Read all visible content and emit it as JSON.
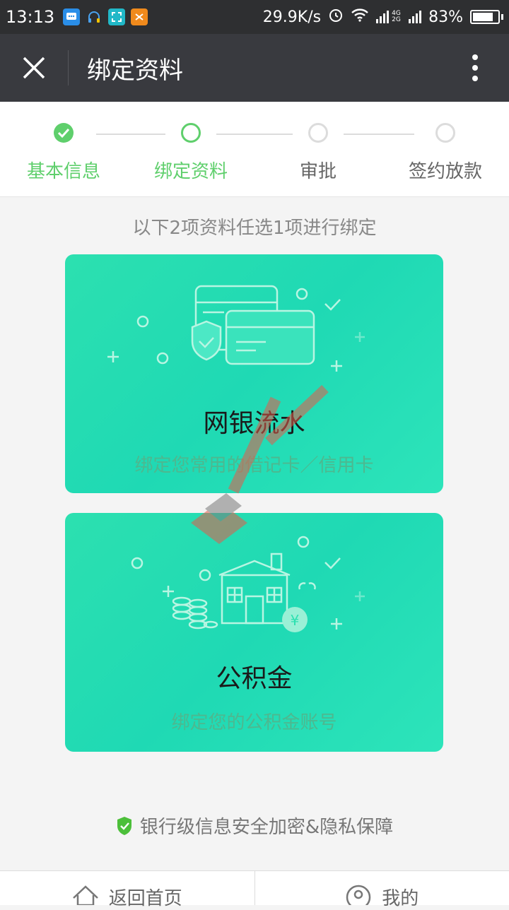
{
  "status_bar": {
    "time": "13:13",
    "net_speed": "29.9K/s",
    "signal_label": "4G 2G",
    "battery_percent": 83,
    "battery_text": "83%"
  },
  "header": {
    "title": "绑定资料",
    "close_icon": "close-icon",
    "more_icon": "more-vertical-icon"
  },
  "steps": [
    {
      "label": "基本信息",
      "state": "done"
    },
    {
      "label": "绑定资料",
      "state": "current"
    },
    {
      "label": "审批",
      "state": "todo"
    },
    {
      "label": "签约放款",
      "state": "todo"
    }
  ],
  "colors": {
    "accent": "#5fcf6c",
    "inactive": "#dcdcdc",
    "card_start": "#2ce0b0",
    "card_end": "#2de4ba"
  },
  "intro": "以下2项资料任选1项进行绑定",
  "cards": [
    {
      "title": "网银流水",
      "desc": "绑定您常用的借记卡／信用卡",
      "icon": "bank-card-icon"
    },
    {
      "title": "公积金",
      "desc": "绑定您的公积金账号",
      "icon": "house-fund-icon"
    }
  ],
  "security_note": "银行级信息安全加密&隐私保障",
  "tabs": [
    {
      "label": "返回首页",
      "icon": "home-icon"
    },
    {
      "label": "我的",
      "icon": "profile-icon"
    }
  ]
}
